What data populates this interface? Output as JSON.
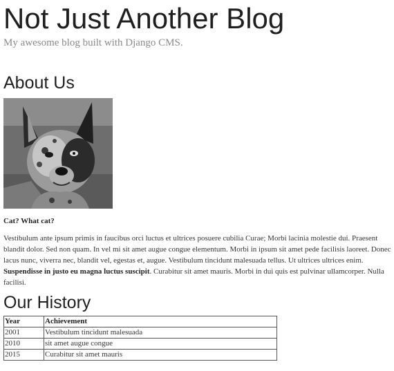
{
  "header": {
    "title": "Not Just Another Blog",
    "tagline": "My awesome blog built with Django CMS."
  },
  "about": {
    "heading": "About Us",
    "caption": "Cat? What cat?",
    "paragraph_part1": "Vestibulum ante ipsum primis in faucibus orci luctus et ultrices posuere cubilia Curae; Morbi lacinia molestie dui. Praesent blandit dolor. Sed non quam. In vel mi sit amet augue congue elementum. Morbi in ipsum sit amet pede facilisis laoreet. Donec lacus nunc, viverra nec, blandit vel, egestas et, augue. Vestibulum tincidunt malesuada tellus. Ut ultrices ultrices enim. ",
    "paragraph_bold": "Suspendisse in justo eu magna luctus suscipit",
    "paragraph_part2": ". Curabitur sit amet mauris. Morbi in dui quis est pulvinar ullamcorper. Nulla facilisi."
  },
  "history": {
    "heading": "Our History",
    "columns": [
      "Year",
      "Achievement"
    ],
    "rows": [
      {
        "year": "2001",
        "achievement": "Vestibulum tincidunt malesuada"
      },
      {
        "year": "2010",
        "achievement": "sit amet augue congue"
      },
      {
        "year": "2015",
        "achievement": "Curabitur sit amet mauris"
      }
    ]
  }
}
